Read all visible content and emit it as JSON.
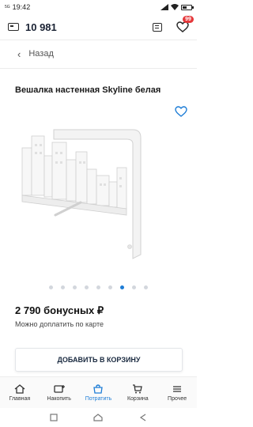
{
  "status_bar": {
    "time": "19:42",
    "network": "5G",
    "battery_level": 0.45
  },
  "app_bar": {
    "wallet_icon": "wallet-icon",
    "balance": "10 981",
    "chat_icon": "chat-icon",
    "wishlist_icon": "heart-icon",
    "wishlist_badge": "99"
  },
  "nav": {
    "back_label": "Назад"
  },
  "product": {
    "title": "Вешалка настенная Skyline белая",
    "favorite_icon": "heart-outline-icon",
    "gallery": {
      "total": 9,
      "active_index": 6
    },
    "price": "2 790 бонусных ₽",
    "price_note": "Можно доплатить по карте",
    "cta_label": "ДОБАВИТЬ В КОРЗИНУ"
  },
  "tabs": [
    {
      "label": "Главная",
      "icon": "home-icon",
      "active": false
    },
    {
      "label": "Накопить",
      "icon": "add-card-icon",
      "active": false
    },
    {
      "label": "Потратить",
      "icon": "shop-icon",
      "active": true
    },
    {
      "label": "Корзина",
      "icon": "cart-icon",
      "active": false
    },
    {
      "label": "Прочее",
      "icon": "more-icon",
      "active": false
    }
  ],
  "colors": {
    "accent": "#1e7dd6",
    "badge": "#e5383b",
    "text_dark": "#1a2233"
  }
}
